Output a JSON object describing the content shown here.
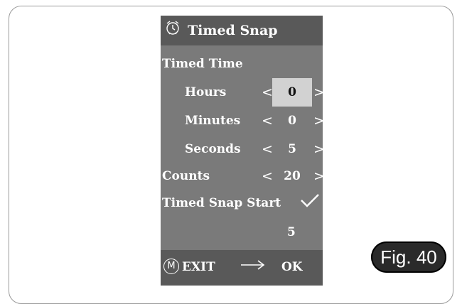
{
  "window": {
    "title": "Timed Snap",
    "icon": "alarm-clock-icon"
  },
  "section_title": "Timed Time",
  "time_fields": [
    {
      "label": "Hours",
      "value": "0",
      "selected": true
    },
    {
      "label": "Minutes",
      "value": "0"
    },
    {
      "label": "Seconds",
      "value": "5"
    }
  ],
  "counts": {
    "label": "Counts",
    "value": "20"
  },
  "arrows": {
    "left": "<",
    "right": ">"
  },
  "start": {
    "label": "Timed Snap Start",
    "checked": true,
    "remaining": "5"
  },
  "footer": {
    "menu_key": "M",
    "exit_label": "EXIT",
    "ok_label": "OK"
  },
  "figure_label": "Fig. 40",
  "colors": {
    "panel": "#7a7a7a",
    "bars": "#595959",
    "selected": "#d2d2d2"
  }
}
